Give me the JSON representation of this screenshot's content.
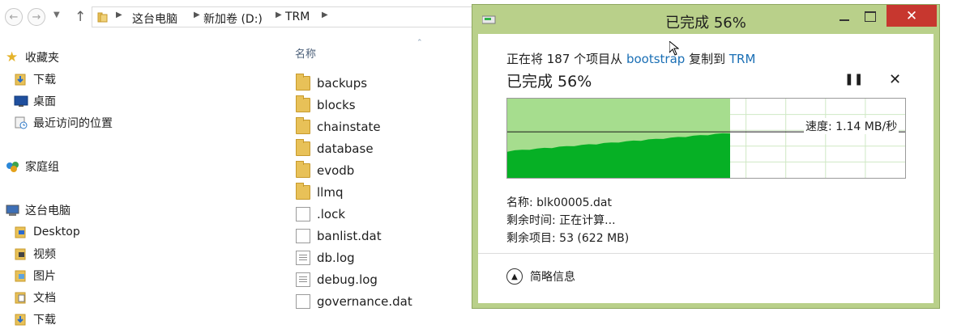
{
  "explorer": {
    "back_icon": "arrow-left",
    "forward_icon": "arrow-right",
    "breadcrumb": [
      "这台电脑",
      "新加卷 (D:)",
      "TRM"
    ],
    "column_header": "名称",
    "nav": {
      "favorites": "收藏夹",
      "favorites_items": [
        "下载",
        "桌面",
        "最近访问的位置"
      ],
      "homegroup": "家庭组",
      "this_pc": "这台电脑",
      "this_pc_items": [
        "Desktop",
        "视频",
        "图片",
        "文档",
        "下载"
      ]
    },
    "files": [
      {
        "name": "backups",
        "type": "folder"
      },
      {
        "name": "blocks",
        "type": "folder"
      },
      {
        "name": "chainstate",
        "type": "folder"
      },
      {
        "name": "database",
        "type": "folder"
      },
      {
        "name": "evodb",
        "type": "folder"
      },
      {
        "name": "llmq",
        "type": "folder"
      },
      {
        "name": ".lock",
        "type": "file"
      },
      {
        "name": "banlist.dat",
        "type": "file"
      },
      {
        "name": "db.log",
        "type": "text"
      },
      {
        "name": "debug.log",
        "type": "text"
      },
      {
        "name": "governance.dat",
        "type": "file"
      }
    ]
  },
  "dialog": {
    "title": "已完成 56%",
    "close_icon": "close",
    "line_prefix": "正在将 187 个项目从",
    "source": "bootstrap",
    "line_mid": "复制到",
    "destination": "TRM",
    "progress_text": "已完成 56%",
    "progress": 0.56,
    "pause_icon": "pause",
    "cancel_icon": "close",
    "speed": "速度: 1.14 MB/秒",
    "name_line": "名称: blk00005.dat",
    "time_line": "剩余时间: 正在计算...",
    "items_line": "剩余项目: 53 (622 MB)",
    "less_details": "简略信息",
    "colors": {
      "frame": "#b9d08a",
      "graph_light": "#a6dd8e",
      "graph_dark": "#06b025",
      "close_button": "#c7372f"
    }
  }
}
